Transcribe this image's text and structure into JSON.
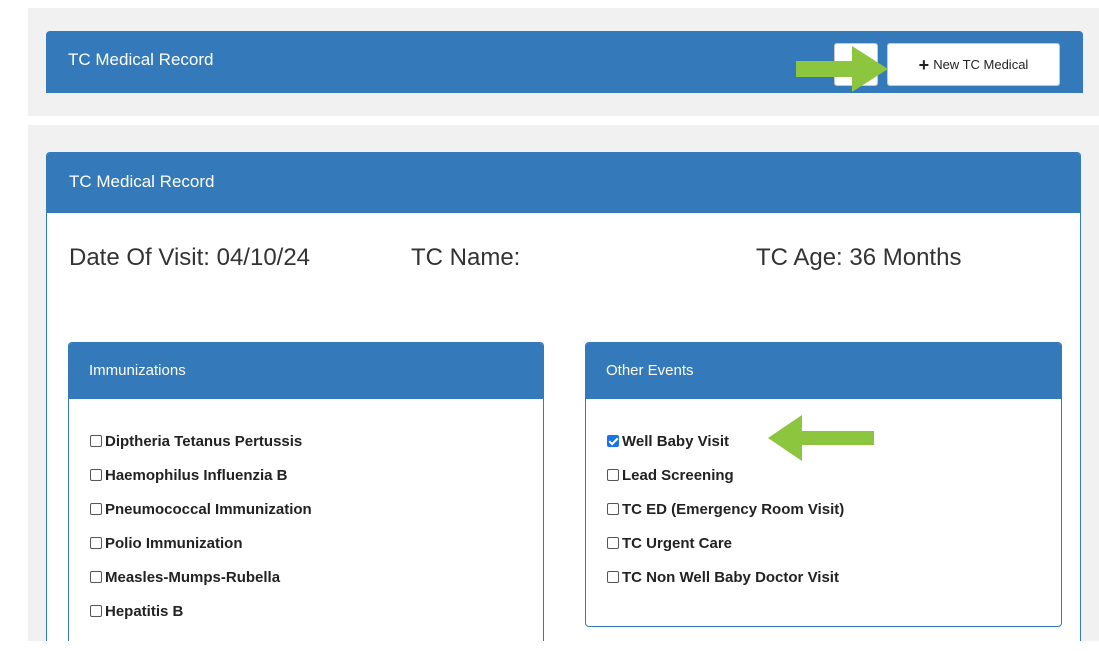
{
  "top_panel": {
    "title": "TC Medical Record",
    "new_button_label": "New TC Medical"
  },
  "main_panel": {
    "title": "TC Medical Record",
    "date_of_visit": "Date Of Visit: 04/10/24",
    "tc_name": "TC Name:",
    "tc_age": "TC Age: 36 Months"
  },
  "immunizations": {
    "title": "Immunizations",
    "items": [
      {
        "label": "Diptheria Tetanus Pertussis",
        "checked": false
      },
      {
        "label": "Haemophilus Influenzia B",
        "checked": false
      },
      {
        "label": "Pneumococcal Immunization",
        "checked": false
      },
      {
        "label": "Polio Immunization",
        "checked": false
      },
      {
        "label": "Measles-Mumps-Rubella",
        "checked": false
      },
      {
        "label": "Hepatitis B",
        "checked": false
      }
    ]
  },
  "other_events": {
    "title": "Other Events",
    "items": [
      {
        "label": "Well Baby Visit",
        "checked": true
      },
      {
        "label": "Lead Screening",
        "checked": false
      },
      {
        "label": "TC ED (Emergency Room Visit)",
        "checked": false
      },
      {
        "label": "TC Urgent Care",
        "checked": false
      },
      {
        "label": "TC Non Well Baby Doctor Visit",
        "checked": false
      }
    ]
  },
  "colors": {
    "header_blue": "#3479b9",
    "arrow_green": "#8cc63f",
    "background_gray": "#f1f1f1"
  }
}
